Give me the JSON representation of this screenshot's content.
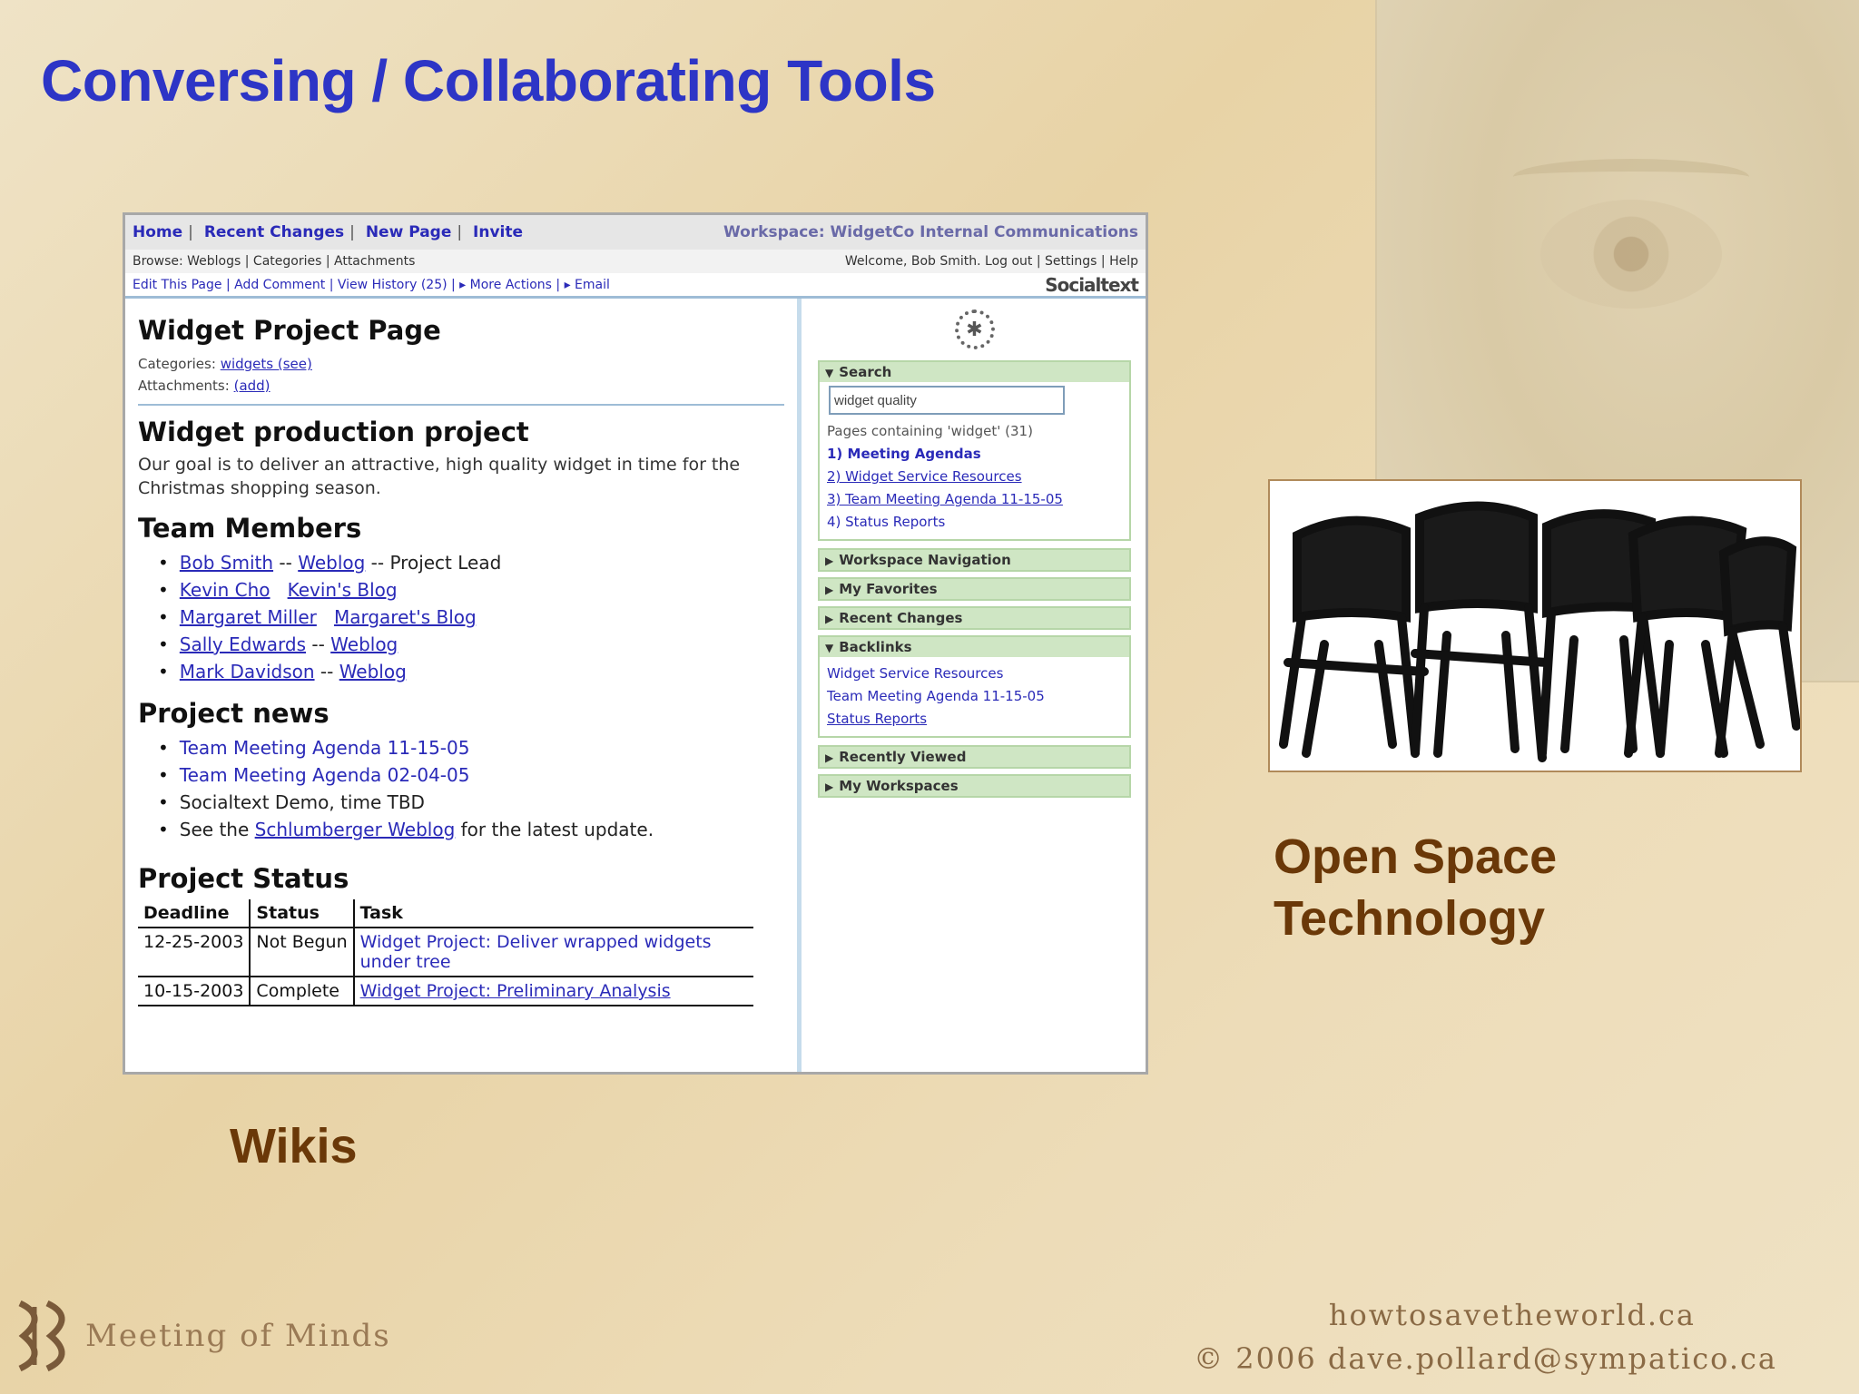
{
  "slide": {
    "title": "Conversing / Collaborating Tools",
    "wikis_label": "Wikis",
    "open_space_label_line1": "Open Space",
    "open_space_label_line2": "Technology",
    "footer_brand": "Meeting of Minds",
    "footer_site": "howtosavetheworld.ca",
    "footer_copyright": "© 2006 dave.pollard@sympatico.ca"
  },
  "wiki": {
    "nav1": [
      "Home",
      "Recent Changes",
      "New Page",
      "Invite"
    ],
    "workspace": "Workspace: WidgetCo Internal Communications",
    "nav2_left": "Browse: Weblogs | Categories | Attachments",
    "nav2_right": "Welcome, Bob Smith. Log out | Settings | Help",
    "nav3_left": "Edit This Page | Add Comment | View History (25) | ▸ More Actions | ▸ Email",
    "logo": "Socialtext",
    "page_title": "Widget Project Page",
    "categories_label": "Categories:",
    "categories_link": "widgets (see)",
    "attachments_label": "Attachments:",
    "attachments_link": "(add)",
    "h_production": "Widget production project",
    "production_text": "Our goal is to deliver an attractive, high quality widget in time for the Christmas shopping season.",
    "h_team": "Team Members",
    "team": [
      {
        "name": "Bob Smith",
        "mid": " -- ",
        "link": "Weblog",
        "rest": " -- Project Lead"
      },
      {
        "name": "Kevin Cho",
        "mid": "   ",
        "link": "Kevin's Blog",
        "rest": ""
      },
      {
        "name": "Margaret Miller",
        "mid": "   ",
        "link": "Margaret's Blog",
        "rest": ""
      },
      {
        "name": "Sally Edwards",
        "mid": " -- ",
        "link": "Weblog",
        "rest": ""
      },
      {
        "name": "Mark Davidson",
        "mid": " -- ",
        "link": "Weblog",
        "rest": ""
      }
    ],
    "h_news": "Project news",
    "news": [
      {
        "pre": "",
        "link": "Team Meeting Agenda 11-15-05",
        "post": ""
      },
      {
        "pre": "",
        "link": "Team Meeting Agenda 02-04-05",
        "post": ""
      },
      {
        "pre": "Socialtext Demo, time TBD",
        "link": "",
        "post": ""
      },
      {
        "pre": "See the ",
        "link": "Schlumberger Weblog",
        "post": " for the latest update."
      }
    ],
    "h_status": "Project Status",
    "status_headers": [
      "Deadline",
      "Status",
      "Task"
    ],
    "status_rows": [
      {
        "deadline": "12-25-2003",
        "status": "Not Begun",
        "task": "Widget Project: Deliver wrapped widgets under tree"
      },
      {
        "deadline": "10-15-2003",
        "status": "Complete",
        "task": "Widget Project: Preliminary Analysis"
      }
    ],
    "sidebar": {
      "search_title": "Search",
      "search_value": "widget quality",
      "search_results_label": "Pages containing 'widget' (31)",
      "search_results": [
        "1) Meeting Agendas",
        "2) Widget Service Resources",
        "3) Team Meeting Agenda 11-15-05",
        "4) Status Reports"
      ],
      "collapsed1": [
        "Workspace Navigation",
        "My Favorites",
        "Recent Changes"
      ],
      "backlinks_title": "Backlinks",
      "backlinks": [
        "Widget Service Resources",
        "Team Meeting Agenda 11-15-05",
        "Status Reports"
      ],
      "collapsed2": [
        "Recently Viewed",
        "My Workspaces"
      ]
    }
  }
}
